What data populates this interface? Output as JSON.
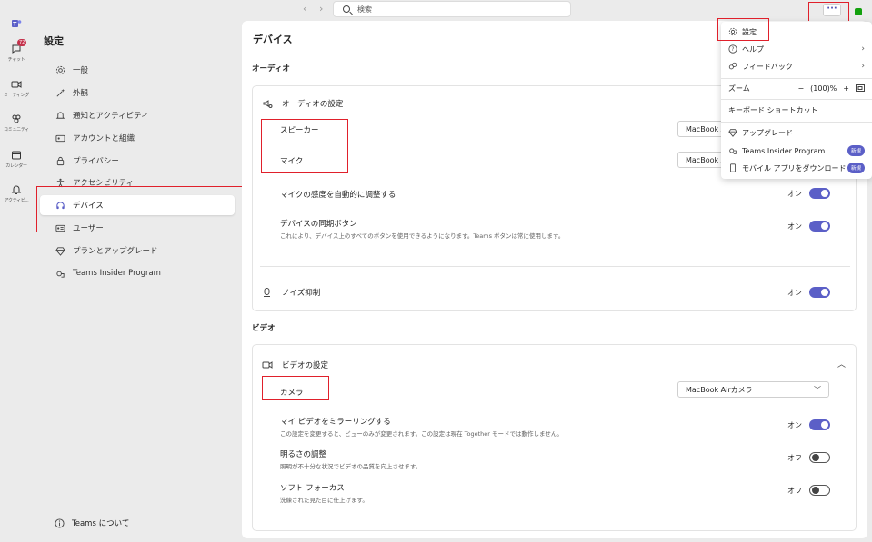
{
  "topbar": {
    "back": "‹",
    "forward": "›",
    "search_placeholder": "検索",
    "more": "···"
  },
  "rail": {
    "teams_logo": "teams-icon",
    "items": [
      {
        "label": "チャット",
        "icon": "chat-icon",
        "badge": "72"
      },
      {
        "label": "ミーティング",
        "icon": "meeting-icon"
      },
      {
        "label": "コミュニティ",
        "icon": "community-icon"
      },
      {
        "label": "カレンダー",
        "icon": "calendar-icon"
      },
      {
        "label": "アクティビ...",
        "icon": "bell-icon"
      }
    ]
  },
  "sidebar": {
    "title": "設定",
    "items": [
      {
        "label": "一般",
        "icon": "gear-icon"
      },
      {
        "label": "外観",
        "icon": "wand-icon"
      },
      {
        "label": "通知とアクティビティ",
        "icon": "bell-icon"
      },
      {
        "label": "アカウントと組織",
        "icon": "id-card-icon"
      },
      {
        "label": "プライバシー",
        "icon": "lock-icon"
      },
      {
        "label": "アクセシビリティ",
        "icon": "accessibility-icon"
      },
      {
        "label": "デバイス",
        "icon": "headset-icon",
        "active": true
      },
      {
        "label": "ユーザー",
        "icon": "contact-card-icon"
      },
      {
        "label": "プランとアップグレード",
        "icon": "diamond-icon"
      },
      {
        "label": "Teams Insider Program",
        "icon": "flask-icon"
      }
    ],
    "about": "Teams について"
  },
  "main": {
    "title": "デバイス",
    "audio": {
      "section": "オーディオ",
      "header": "オーディオの設定",
      "speaker_label": "スピーカー",
      "speaker_value": "MacBook Air",
      "mic_label": "マイク",
      "mic_value": "MacBook Air",
      "auto_sens_label": "マイクの感度を自動的に調整する",
      "auto_sens_state": "オン",
      "sync_label": "デバイスの同期ボタン",
      "sync_sub": "これにより、デバイス上のすべてのボタンを使用できるようになります。Teams ボタンは常に使用します。",
      "sync_state": "オン",
      "noise_label": "ノイズ抑制",
      "noise_state": "オン"
    },
    "video": {
      "section": "ビデオ",
      "header": "ビデオの設定",
      "camera_label": "カメラ",
      "camera_value": "MacBook Airカメラ",
      "mirror_label": "マイ ビデオをミラーリングする",
      "mirror_sub": "この設定を変更すると、ビューのみが変更されます。この設定は現在 Together モードでは動作しません。",
      "mirror_state": "オン",
      "brightness_label": "明るさの調整",
      "brightness_sub": "照明が不十分な状況でビデオの品質を向上させます。",
      "brightness_state": "オフ",
      "soft_label": "ソフト フォーカス",
      "soft_sub": "洗練された見た目に仕上げます。",
      "soft_state": "オフ"
    }
  },
  "menu": {
    "settings": "設定",
    "help": "ヘルプ",
    "feedback": "フィードバック",
    "zoom": "ズーム",
    "zoom_minus": "−",
    "zoom_value": "(100)%",
    "zoom_plus": "+",
    "shortcuts": "キーボード ショートカット",
    "upgrade": "アップグレード",
    "insider": "Teams Insider Program",
    "mobile": "モバイル アプリをダウンロード",
    "new_badge": "新規"
  },
  "colors": {
    "accent": "#5b5fc7",
    "highlight": "#e0202b",
    "badge": "#c4314b"
  }
}
